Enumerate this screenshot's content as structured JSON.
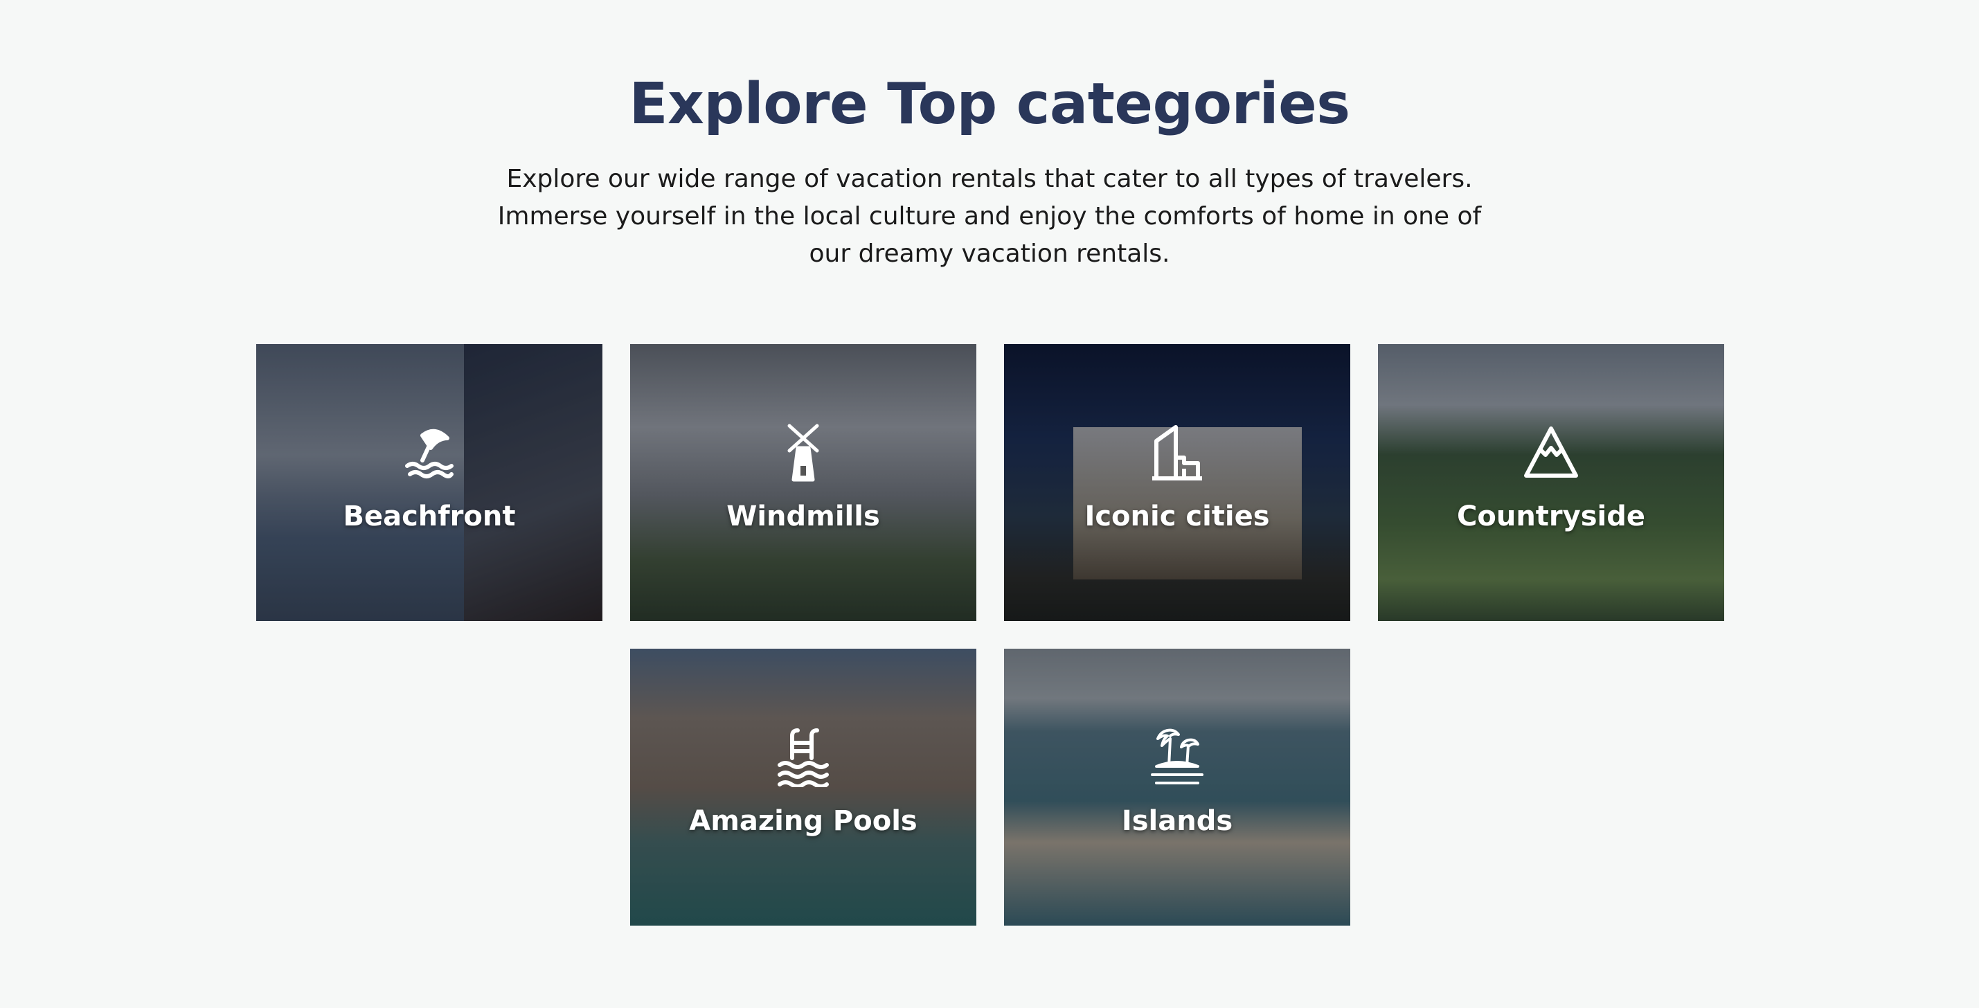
{
  "section": {
    "title": "Explore Top categories",
    "subtitle": "Explore our wide range of vacation rentals that cater to all types of travelers. Immerse yourself in the local culture and enjoy the comforts of home in one of our dreamy vacation rentals."
  },
  "categories": [
    {
      "label": "Beachfront",
      "icon": "beach-umbrella-icon"
    },
    {
      "label": "Windmills",
      "icon": "windmill-icon"
    },
    {
      "label": "Iconic cities",
      "icon": "city-buildings-icon"
    },
    {
      "label": "Countryside",
      "icon": "mountain-icon"
    },
    {
      "label": "Amazing Pools",
      "icon": "pool-ladder-icon"
    },
    {
      "label": "Islands",
      "icon": "palm-island-icon"
    }
  ],
  "colors": {
    "background": "#f6f8f7",
    "title": "#2a375a",
    "body_text": "#1b1b1b",
    "card_label": "#ffffff"
  }
}
